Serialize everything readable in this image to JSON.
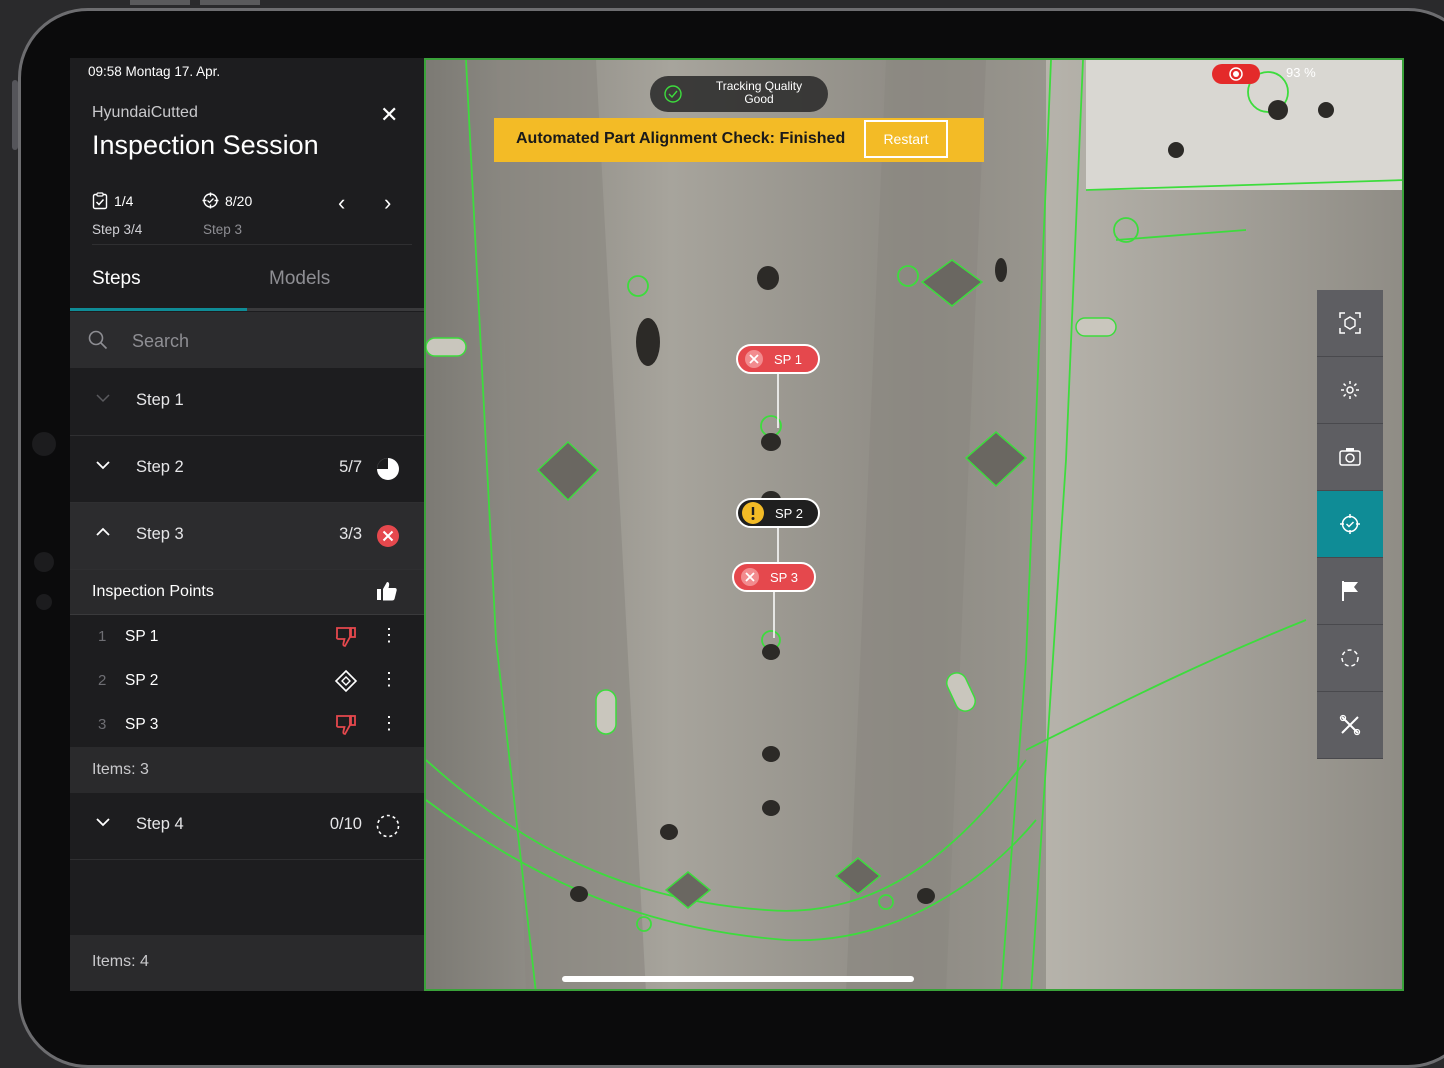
{
  "status": {
    "time_date": "09:58  Montag 17. Apr.",
    "battery": "93 %"
  },
  "session": {
    "project": "HyundaiCutted",
    "title": "Inspection Session"
  },
  "counters": [
    {
      "value": "1/4",
      "label": "Step 3/4",
      "icon": "clipboard-check-icon"
    },
    {
      "value": "8/20",
      "label": "Step 3",
      "icon": "target-icon"
    }
  ],
  "tabs": [
    {
      "label": "Steps",
      "active": true
    },
    {
      "label": "Models",
      "active": false
    }
  ],
  "search": {
    "placeholder": "Search"
  },
  "steps": [
    {
      "label": "Step 1",
      "count": "",
      "status": "none",
      "expanded": false
    },
    {
      "label": "Step 2",
      "count": "5/7",
      "status": "partial-pie",
      "expanded": false
    },
    {
      "label": "Step 3",
      "count": "3/3",
      "status": "failed",
      "expanded": true
    },
    {
      "label": "Step 4",
      "count": "0/10",
      "status": "not-started",
      "expanded": false
    }
  ],
  "inspection_points": {
    "header": "Inspection Points",
    "header_icon": "thumbs-up-icon",
    "items": [
      {
        "num": "1",
        "name": "SP 1",
        "result_icon": "thumbs-down-icon",
        "color": "#e5484d"
      },
      {
        "num": "2",
        "name": "SP 2",
        "result_icon": "diamond-icon",
        "color": "#ffffff"
      },
      {
        "num": "3",
        "name": "SP 3",
        "result_icon": "thumbs-down-icon",
        "color": "#e5484d"
      }
    ],
    "items_label": "Items: 3"
  },
  "footer": {
    "items_label": "Items: 4"
  },
  "ar": {
    "tracking": {
      "line1": "Tracking Quality",
      "line2": "Good"
    },
    "banner": {
      "message": "Automated Part Alignment Check: Finished",
      "button": "Restart"
    },
    "markers": [
      {
        "label": "SP 1",
        "status": "failed"
      },
      {
        "label": "SP 2",
        "status": "warning"
      },
      {
        "label": "SP 3",
        "status": "failed"
      }
    ],
    "toolbar": [
      "scan-icon",
      "settings-icon",
      "camera-icon",
      "target-icon",
      "flag-icon",
      "reset-icon",
      "tools-icon"
    ],
    "active_tool": "target-icon"
  },
  "colors": {
    "accent": "#0f8c96",
    "fail": "#e5484d",
    "warning": "#f3bb26",
    "outline": "#3ddc3d"
  }
}
